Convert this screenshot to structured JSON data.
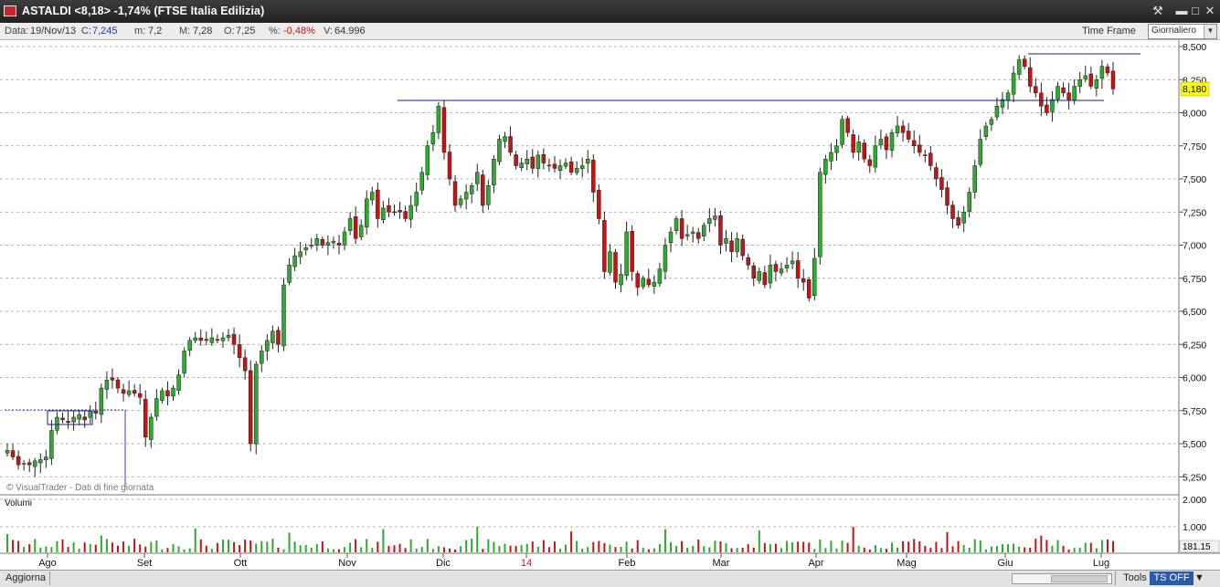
{
  "window": {
    "title": "ASTALDI <8,18> -1,74%  (FTSE Italia Edilizia)"
  },
  "infobar": {
    "data_label": "Data:",
    "data_value": "19/Nov/13",
    "c_label": "C:",
    "c_value": "7,245",
    "m_label": "m:",
    "m_value": "7,2",
    "M_label": "M:",
    "M_value": "7,28",
    "o_label": "O:",
    "o_value": "7,25",
    "pct_label": "%:",
    "pct_value": "-0,48%",
    "v_label": "V:",
    "v_value": "64.996",
    "timeframe_label": "Time Frame",
    "timeframe_value": "Giornaliero"
  },
  "chart": {
    "watermark": "© VisualTrader - Dati di fine giornata",
    "volume_label": "Volumi",
    "last_price_label": "8,180",
    "bottom_right_value": "181.15",
    "colors": {
      "up": "#2eaa2e",
      "down": "#c41414",
      "grid": "#9a9a9a",
      "line": "#1e1e8c",
      "price_tag": "#ffff00"
    }
  },
  "chart_data": {
    "type": "candlestick",
    "price_axis": {
      "ticks": [
        "8,500",
        "8,250",
        "8,000",
        "7,750",
        "7,500",
        "7,250",
        "7,000",
        "6,750",
        "6,500",
        "6,250",
        "6,000",
        "5,750",
        "5,500",
        "5,250"
      ],
      "range": [
        5.2,
        8.55
      ]
    },
    "volume_axis": {
      "ticks": [
        "2.000",
        "1.000"
      ],
      "range": [
        0,
        2000
      ]
    },
    "x_labels": [
      "Ago",
      "Set",
      "Ott",
      "Nov",
      "Dic",
      "14",
      "Feb",
      "Mar",
      "Apr",
      "Mag",
      "Giu",
      "Lug"
    ],
    "close": [
      5.45,
      5.4,
      5.34,
      5.35,
      5.34,
      5.37,
      5.38,
      5.4,
      5.6,
      5.7,
      5.68,
      5.66,
      5.7,
      5.72,
      5.68,
      5.75,
      5.73,
      5.92,
      5.98,
      5.98,
      5.92,
      5.88,
      5.9,
      5.88,
      5.85,
      5.55,
      5.7,
      5.84,
      5.9,
      5.86,
      5.92,
      6.02,
      6.2,
      6.28,
      6.3,
      6.28,
      6.28,
      6.3,
      6.28,
      6.3,
      6.32,
      6.25,
      6.15,
      6.05,
      5.5,
      6.1,
      6.2,
      6.28,
      6.35,
      6.25,
      6.7,
      6.85,
      6.92,
      6.95,
      6.98,
      7.0,
      7.05,
      7.0,
      7.02,
      7.03,
      7.0,
      7.1,
      7.2,
      7.05,
      7.15,
      7.35,
      7.4,
      7.2,
      7.28,
      7.25,
      7.25,
      7.25,
      7.2,
      7.3,
      7.4,
      7.55,
      7.75,
      7.85,
      8.05,
      7.7,
      7.5,
      7.3,
      7.35,
      7.4,
      7.45,
      7.55,
      7.3,
      7.45,
      7.65,
      7.8,
      7.82,
      7.7,
      7.6,
      7.62,
      7.65,
      7.58,
      7.68,
      7.62,
      7.6,
      7.58,
      7.6,
      7.62,
      7.55,
      7.58,
      7.6,
      7.65,
      7.4,
      7.2,
      6.8,
      6.95,
      6.72,
      6.78,
      7.1,
      6.8,
      6.68,
      6.75,
      6.7,
      6.72,
      6.82,
      7.0,
      7.1,
      7.2,
      7.05,
      7.08,
      7.1,
      7.05,
      7.15,
      7.2,
      7.22,
      7.0,
      7.05,
      6.95,
      7.05,
      6.92,
      6.85,
      6.75,
      6.8,
      6.7,
      6.85,
      6.8,
      6.82,
      6.85,
      6.88,
      6.75,
      6.72,
      6.6,
      6.9,
      7.55,
      7.65,
      7.7,
      7.75,
      7.95,
      7.85,
      7.7,
      7.78,
      7.65,
      7.6,
      7.75,
      7.8,
      7.72,
      7.85,
      7.9,
      7.85,
      7.8,
      7.75,
      7.7,
      7.68,
      7.6,
      7.5,
      7.42,
      7.3,
      7.2,
      7.15,
      7.25,
      7.4,
      7.6,
      7.8,
      7.9,
      7.95,
      8.05,
      8.1,
      8.15,
      8.3,
      8.4,
      8.35,
      8.2,
      8.15,
      8.05,
      8.0,
      8.1,
      8.2,
      8.15,
      8.1,
      8.2,
      8.25,
      8.28,
      8.2,
      8.25,
      8.35,
      8.3,
      8.18
    ]
  }
}
